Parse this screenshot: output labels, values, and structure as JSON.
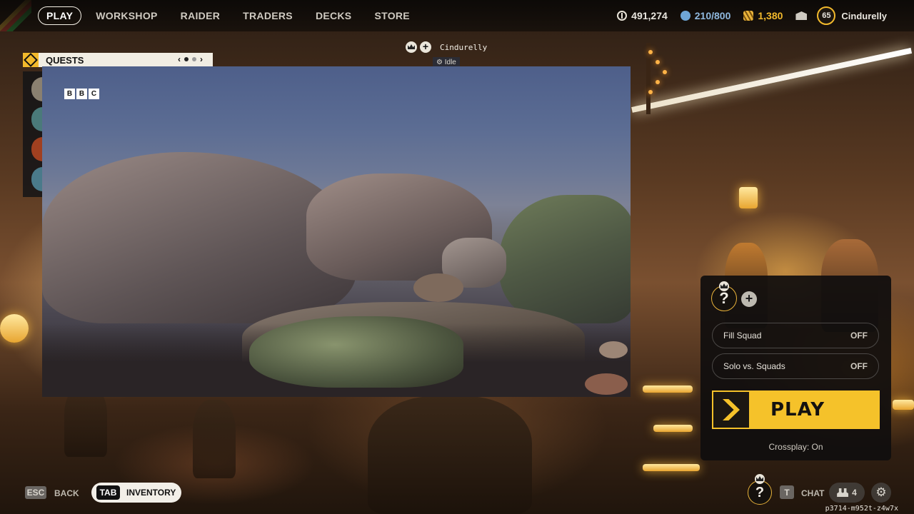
{
  "nav": {
    "items": [
      "PLAY",
      "WORKSHOP",
      "RAIDER",
      "TRADERS",
      "DECKS",
      "STORE"
    ],
    "active": "PLAY"
  },
  "currency": {
    "coins": "491,274",
    "blue": "210/800",
    "gold": "1,380"
  },
  "profile": {
    "level": "65",
    "username": "Cindurelly"
  },
  "lobby": {
    "player_name": "Cindurelly",
    "status": "Idle"
  },
  "quests": {
    "title": "QUESTS"
  },
  "video": {
    "watermark": [
      "B",
      "B",
      "C"
    ]
  },
  "panel": {
    "slot_glyph": "?",
    "fill_squad": {
      "label": "Fill Squad",
      "value": "OFF"
    },
    "solo_vs_squads": {
      "label": "Solo vs. Squads",
      "value": "OFF"
    },
    "play_label": "PLAY",
    "crossplay": "Crossplay: On"
  },
  "bottom": {
    "esc_key": "ESC",
    "back_label": "BACK",
    "tab_key": "TAB",
    "inventory_label": "INVENTORY",
    "slot_glyph": "?",
    "t_key": "T",
    "chat_label": "CHAT",
    "friends_count": "4",
    "build_id": "p3714-m952t-z4w7x"
  },
  "colors": {
    "accent_yellow": "#f5c22a",
    "panel_bg": "#100e0e"
  }
}
